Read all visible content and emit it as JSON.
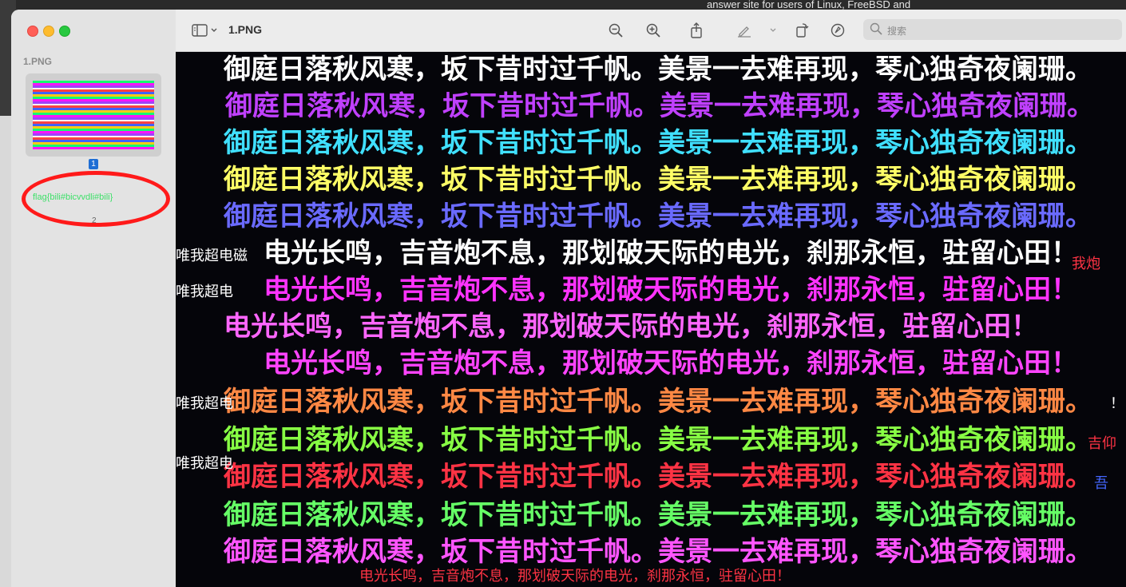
{
  "background_window": {
    "visible_text": "answer site for users of Linux, FreeBSD and"
  },
  "window": {
    "title": "1.PNG"
  },
  "sidebar": {
    "section_label": "1.PNG",
    "page1_number": "1",
    "flag_text": "flag{bili#bicvvdli#bili}",
    "page2_number": "2"
  },
  "toolbar": {
    "search_placeholder": "搜索",
    "icons": [
      "sidebar-toggle-icon",
      "chevron-down-icon",
      "zoom-out-icon",
      "zoom-in-icon",
      "share-icon",
      "markup-pen-icon",
      "chevron-down-icon",
      "rotate-icon",
      "markup-circle-icon",
      "search-icon"
    ]
  },
  "image_text": {
    "poem_a": "御庭日落秋风寒，坂下昔时过千帆。美景一去难再现，琴心独奇夜阑珊。",
    "poem_b": "电光长鸣，吉音炮不息，那划破天际的电光，刹那永恒，驻留心田！",
    "poem_b_bottom": "电光长鸣，吉音炮不息，那划破天际的电光，刹那永恒，驻留心田！",
    "fragment_left_1": "唯我超电磁",
    "fragment_left_2": "唯我超电",
    "fragment_left_3": "唯我超电",
    "fragment_left_4": "唯我超电",
    "fragment_right_1": "！",
    "fragment_right_2": "我炮",
    "fragment_right_3": "吉仰",
    "fragment_right_4": "吾"
  },
  "colors": {
    "accent_flag": "#3fe06a",
    "annotation_circle": "#ff1a1a",
    "page_badge": "#1f6ed4"
  }
}
